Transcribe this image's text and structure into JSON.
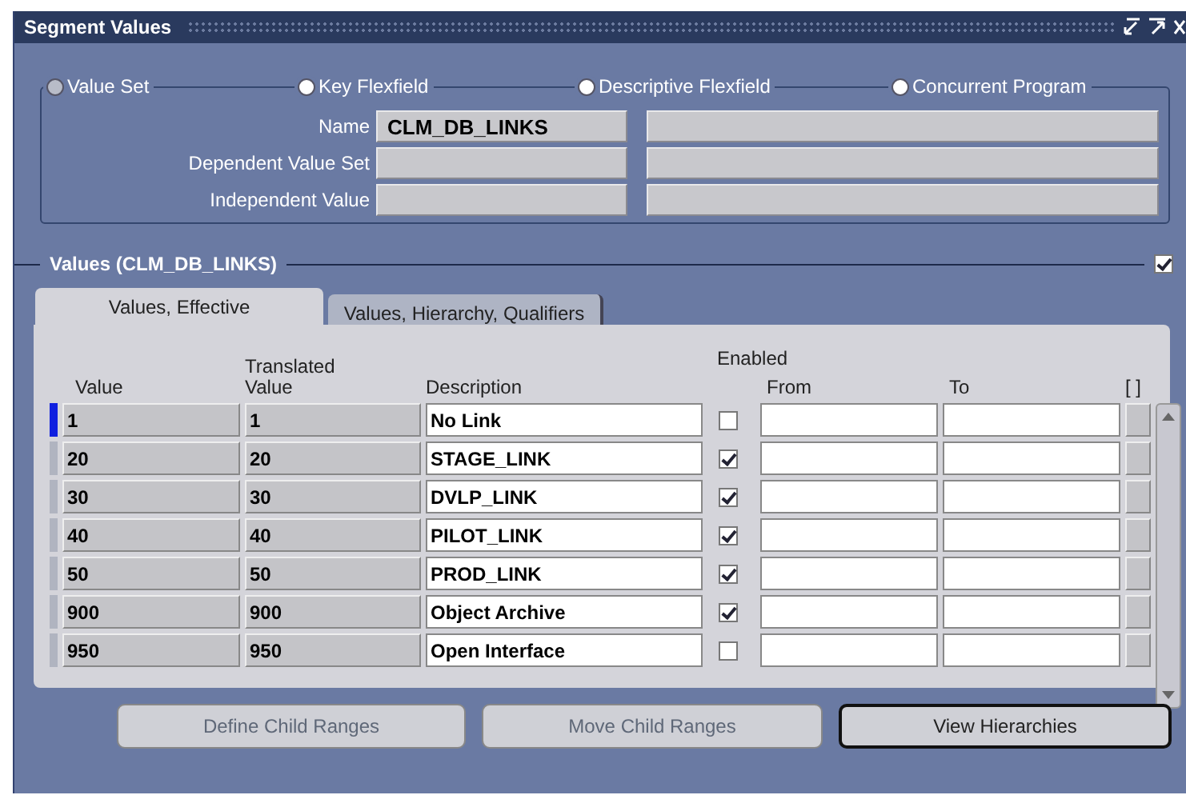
{
  "window": {
    "title": "Segment Values"
  },
  "radio_options": [
    {
      "label": "Value Set",
      "selected": true
    },
    {
      "label": "Key Flexfield",
      "selected": false
    },
    {
      "label": "Descriptive Flexfield",
      "selected": false
    },
    {
      "label": "Concurrent Program",
      "selected": false
    }
  ],
  "fields": [
    {
      "label": "Name",
      "value": "CLM_DB_LINKS"
    },
    {
      "label": "Dependent Value Set"
    },
    {
      "label": "Independent Value"
    }
  ],
  "values_section": {
    "title": "Values (CLM_DB_LINKS)",
    "checked": true
  },
  "tabs": [
    {
      "label": "Values, Effective",
      "selected": true
    },
    {
      "label": "Values, Hierarchy, Qualifiers",
      "selected": false
    }
  ],
  "table": {
    "columns": [
      "Value",
      "Translated Value",
      "Description",
      "Enabled",
      "From",
      "To",
      "[ ]"
    ],
    "rows": [
      {
        "value": "1",
        "translated_value": "1",
        "description": "No Link",
        "enabled": false,
        "current": true
      },
      {
        "value": "20",
        "translated_value": "20",
        "description": "STAGE_LINK",
        "enabled": true,
        "current": false
      },
      {
        "value": "30",
        "translated_value": "30",
        "description": "DVLP_LINK",
        "enabled": true,
        "current": false
      },
      {
        "value": "40",
        "translated_value": "40",
        "description": "PILOT_LINK",
        "enabled": true,
        "current": false
      },
      {
        "value": "50",
        "translated_value": "50",
        "description": "PROD_LINK",
        "enabled": true,
        "current": false
      },
      {
        "value": "900",
        "translated_value": "900",
        "description": "Object Archive",
        "enabled": true,
        "current": false
      },
      {
        "value": "950",
        "translated_value": "950",
        "description": "Open Interface",
        "enabled": false,
        "current": false
      }
    ]
  },
  "buttons": [
    {
      "label": "Define Child Ranges",
      "disabled": true
    },
    {
      "label": "Move Child Ranges",
      "disabled": true
    },
    {
      "label": "View Hierarchies",
      "disabled": false
    }
  ]
}
